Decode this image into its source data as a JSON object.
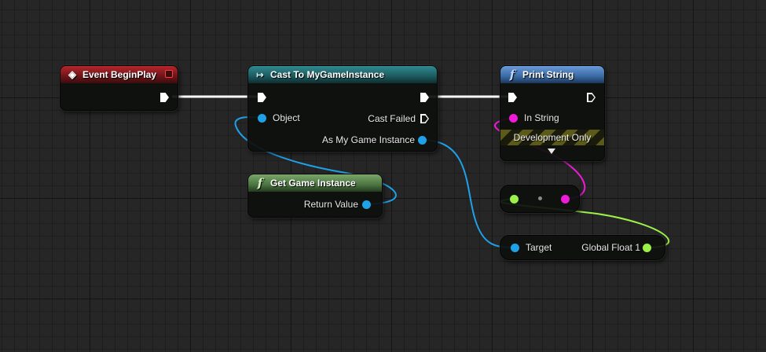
{
  "graph": {
    "nodes": {
      "event_begin_play": {
        "title": "Event BeginPlay"
      },
      "cast": {
        "title": "Cast To MyGameInstance",
        "pins": {
          "object": "Object",
          "cast_failed": "Cast Failed",
          "as_instance": "As My Game Instance"
        }
      },
      "print_string": {
        "title": "Print String",
        "pins": {
          "in_string": "In String"
        },
        "development_only": "Development Only"
      },
      "get_game_instance": {
        "title": "Get Game Instance",
        "pins": {
          "return_value": "Return Value"
        }
      },
      "get_variable": {
        "pins": {
          "target": "Target",
          "global_float": "Global Float 1"
        }
      }
    },
    "pin_colors": {
      "exec": "#ffffff",
      "object": "#1fa1e8",
      "string": "#f01bd8",
      "float": "#9cf04a"
    },
    "header_colors": {
      "event": "#8c1c20",
      "cast": "#237076",
      "function": "#4a7cbc",
      "pure_function": "#5a8a4c"
    },
    "icons": {
      "event": "event-diamond-icon",
      "cast": "cast-arrow-icon",
      "function": "function-f-icon",
      "delegate": "delegate-square-icon",
      "expand": "expand-triangle-icon"
    }
  }
}
